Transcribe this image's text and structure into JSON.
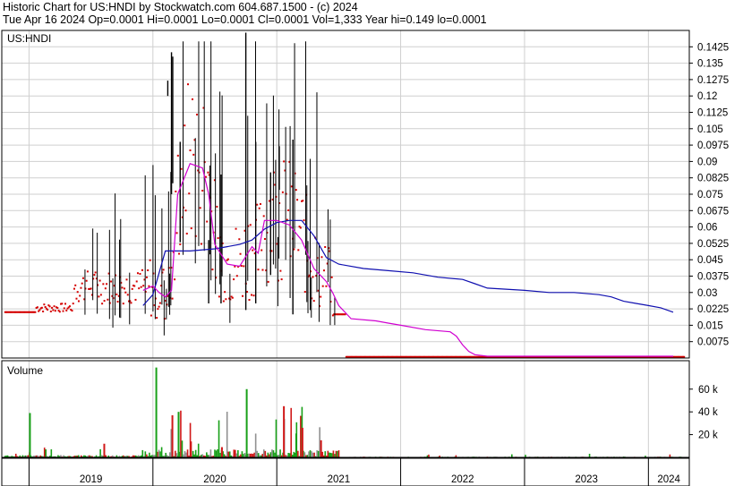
{
  "header": {
    "line1": "Historic Chart for US:HNDI by Stockwatch.com 604.687.1500 - (c) 2024",
    "line2": "Tue Apr 16 2024   Op=0.0001   Hi=0.0001   Lo=0.0001   Cl=0.0001   Vol=1,333   Year hi=0.149   lo=0.0001"
  },
  "chart_data": [
    {
      "type": "line",
      "title": "US:HNDI",
      "ylim": [
        0,
        0.15
      ],
      "y_ticks": [
        "0.1425",
        "0.135",
        "0.1275",
        "0.12",
        "0.1125",
        "0.105",
        "0.0975",
        "0.09",
        "0.0825",
        "0.075",
        "0.0675",
        "0.06",
        "0.0525",
        "0.045",
        "0.0375",
        "0.03",
        "0.0225",
        "0.015",
        "0.0075"
      ],
      "x_ticks": [
        "2019",
        "2020",
        "2021",
        "2022",
        "2023",
        "2024"
      ],
      "grid": true,
      "colors": {
        "price_bar": "#000000",
        "close_mark": "#d40000",
        "long_avg": "#1010b0",
        "short_avg": "#d000d0"
      },
      "long_avg": {
        "t": [
          2019.92,
          2020.0,
          2020.1,
          2020.3,
          2020.5,
          2020.6,
          2020.7,
          2020.8,
          2020.9,
          2021.0,
          2021.1,
          2021.2,
          2021.3,
          2021.4,
          2021.5,
          2021.7,
          2021.9,
          2022.1,
          2022.3,
          2022.5,
          2022.6,
          2022.7,
          2023.0,
          2023.2,
          2023.4,
          2023.6,
          2023.7,
          2023.8,
          2023.9,
          2024.0,
          2024.1,
          2024.2
        ],
        "v": [
          0.024,
          0.029,
          0.049,
          0.049,
          0.05,
          0.051,
          0.052,
          0.054,
          0.059,
          0.062,
          0.063,
          0.063,
          0.056,
          0.046,
          0.043,
          0.041,
          0.04,
          0.039,
          0.037,
          0.036,
          0.034,
          0.032,
          0.031,
          0.03,
          0.03,
          0.029,
          0.028,
          0.026,
          0.025,
          0.024,
          0.023,
          0.021
        ]
      },
      "short_avg": {
        "t": [
          2019.92,
          2020.0,
          2020.05,
          2020.1,
          2020.15,
          2020.2,
          2020.3,
          2020.4,
          2020.45,
          2020.5,
          2020.6,
          2020.7,
          2020.8,
          2020.85,
          2020.9,
          2021.0,
          2021.1,
          2021.2,
          2021.3,
          2021.4,
          2021.45,
          2021.5,
          2021.6,
          2021.8,
          2021.9,
          2022.0,
          2022.2,
          2022.4,
          2022.45,
          2022.5,
          2022.55,
          2022.6,
          2022.7,
          2023.0,
          2024.2
        ],
        "v": [
          0.031,
          0.033,
          0.03,
          0.028,
          0.031,
          0.075,
          0.089,
          0.087,
          0.075,
          0.052,
          0.043,
          0.042,
          0.051,
          0.048,
          0.063,
          0.063,
          0.061,
          0.054,
          0.041,
          0.035,
          0.03,
          0.024,
          0.018,
          0.017,
          0.016,
          0.015,
          0.013,
          0.012,
          0.01,
          0.006,
          0.003,
          0.0015,
          0.0008,
          0.0008,
          0.0008
        ]
      }
    },
    {
      "type": "bar",
      "title": "Volume",
      "ylim": [
        0,
        85000
      ],
      "y_ticks": [
        "60 k",
        "40 k",
        "20 k"
      ]
    }
  ]
}
